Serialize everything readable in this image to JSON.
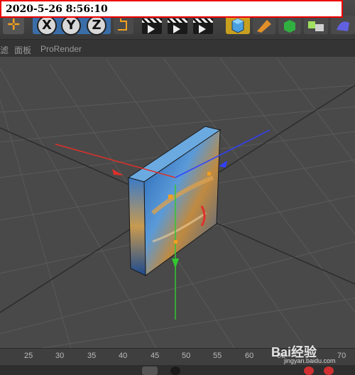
{
  "timestamp": "2020-5-26 8:56:10",
  "toolbar": {
    "axis_buttons": [
      "X",
      "Y",
      "Z"
    ]
  },
  "menubar": {
    "items": [
      "滤",
      "面板",
      "ProRender"
    ]
  },
  "timeline": {
    "ticks": [
      "25",
      "30",
      "35",
      "40",
      "45",
      "50",
      "55",
      "60",
      "65",
      "70"
    ]
  },
  "watermark": {
    "text": "Bai经验",
    "sub": "jingyan.baidu.com"
  },
  "colors": {
    "x_axis": "#e0302a",
    "y_axis": "#32c832",
    "z_axis": "#3040ff",
    "timestamp_border": "#ee0000"
  },
  "icons": [
    "move-icon",
    "coordinate-system-icon",
    "render-view-icon",
    "render-picture-viewer-icon",
    "render-settings-icon",
    "cube-icon",
    "pen-icon",
    "subdivision-icon",
    "array-icon",
    "deformer-icon"
  ]
}
